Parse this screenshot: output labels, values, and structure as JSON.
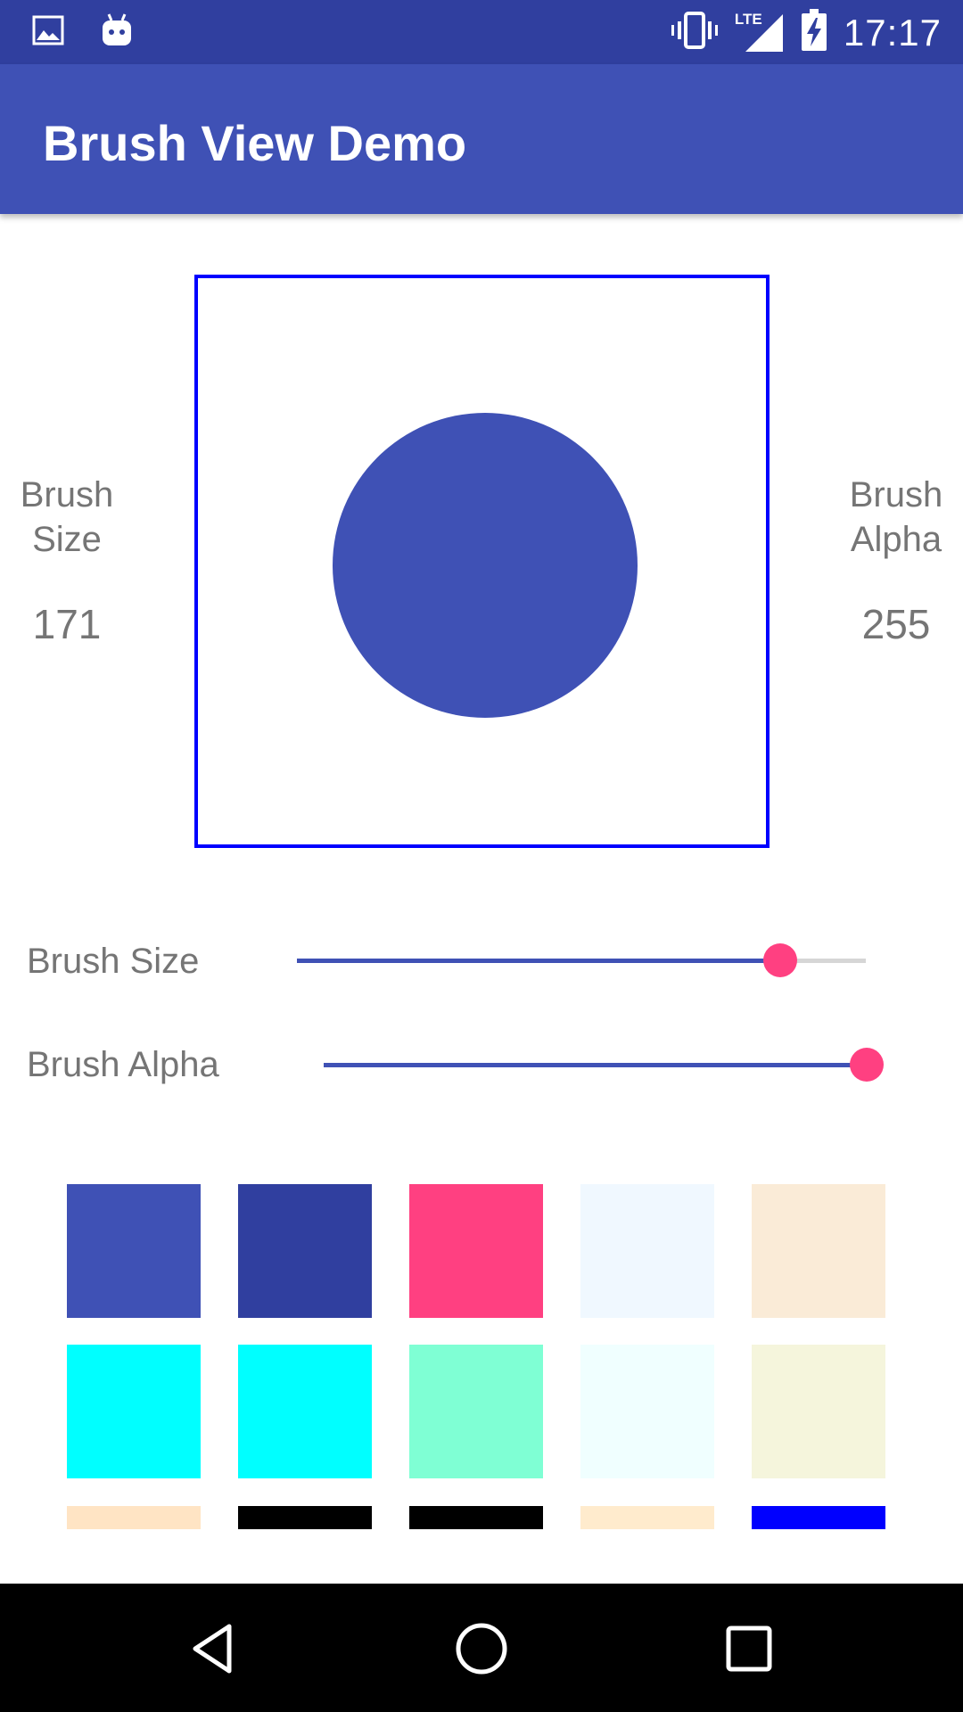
{
  "status_bar": {
    "time": "17:17",
    "network": "LTE",
    "icons": [
      "image-notification-icon",
      "android-notification-icon",
      "vibrate-icon",
      "lte-signal-icon",
      "battery-charging-icon"
    ],
    "background": "#303f9f"
  },
  "app_bar": {
    "title": "Brush View Demo",
    "background": "#3f51b5"
  },
  "preview": {
    "left_label": "Brush\nSize",
    "left_value": "171",
    "right_label": "Brush\nAlpha",
    "right_value": "255",
    "border_color": "#0000ff",
    "brush_color": "#3f51b5"
  },
  "sliders": {
    "size": {
      "label": "Brush Size",
      "value_fraction": 0.85
    },
    "alpha": {
      "label": "Brush Alpha",
      "value_fraction": 1.0
    },
    "track_color": "#3f51b5",
    "thumb_color": "#ff4081"
  },
  "swatches": {
    "row1": [
      "#3f51b5",
      "#303f9f",
      "#ff4081",
      "#f0f8ff",
      "#faebd7"
    ],
    "row2": [
      "#00ffff",
      "#00ffff",
      "#7fffd4",
      "#f0ffff",
      "#f5f5dc"
    ],
    "row3": [
      "#ffe4c4",
      "#000000",
      "#000000",
      "#ffebcd",
      "#0000ff"
    ]
  },
  "nav_bar": {
    "buttons": [
      "back-icon",
      "home-icon",
      "recents-icon"
    ]
  }
}
